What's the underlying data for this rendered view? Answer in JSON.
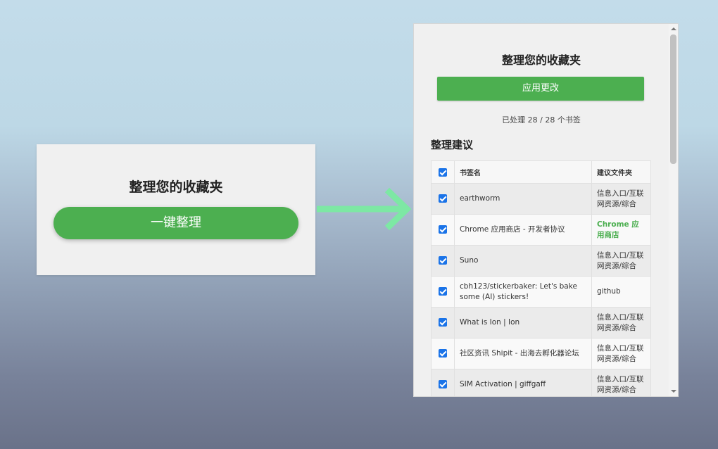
{
  "left_popup": {
    "title": "整理您的收藏夹",
    "button_label": "一键整理"
  },
  "right_popup": {
    "title": "整理您的收藏夹",
    "apply_label": "应用更改",
    "status": "已处理 28 / 28 个书签",
    "section_title": "整理建议",
    "table": {
      "headers": [
        "书签名",
        "建议文件夹"
      ],
      "rows": [
        {
          "name": "earthworm",
          "folder": "信息入口/互联网资源/综合",
          "checked": true
        },
        {
          "name": "Chrome 应用商店 - 开发者协议",
          "folder": "Chrome 应用商店",
          "checked": true,
          "highlight": true
        },
        {
          "name": "Suno",
          "folder": "信息入口/互联网资源/综合",
          "checked": true
        },
        {
          "name": "cbh123/stickerbaker: Let's bake some (AI) stickers!",
          "folder": "github",
          "checked": true
        },
        {
          "name": "What is Ion | Ion",
          "folder": "信息入口/互联网资源/综合",
          "checked": true
        },
        {
          "name": "社区资讯 Shipit - 出海去孵化器论坛",
          "folder": "信息入口/互联网资源/综合",
          "checked": true
        },
        {
          "name": "SIM Activation | giffgaff",
          "folder": "信息入口/互联网资源/综合",
          "checked": true
        }
      ]
    }
  },
  "colors": {
    "accent_green": "#4caf50",
    "arrow_green": "#7de8a4",
    "checkbox_blue": "#1a73e8"
  },
  "icons": {
    "arrow": "arrow-right-icon",
    "checkbox": "checkbox-checked-icon"
  }
}
